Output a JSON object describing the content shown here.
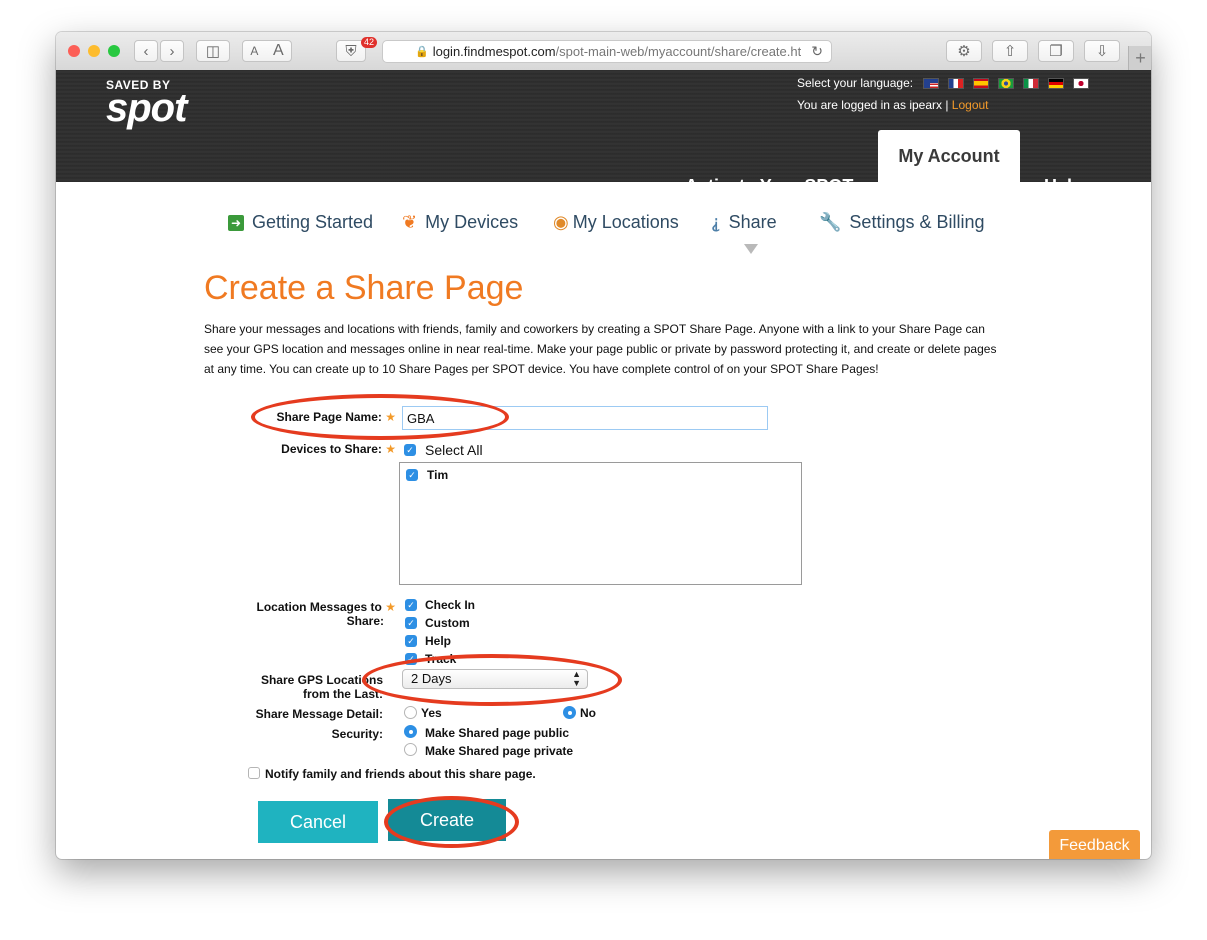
{
  "browser": {
    "url_host": "login.findmespot.com",
    "url_path": "/spot-main-web/myaccount/share/create.ht",
    "badge_count": "42",
    "reader_small": "A",
    "reader_large": "A"
  },
  "header": {
    "logo_top": "SAVED BY",
    "logo_main": "spot",
    "language_label": "Select your language:",
    "logged_in_text": "You are logged in as ipearx |",
    "logout_label": "Logout",
    "nav": [
      "Activate Your SPOT",
      "My Account",
      "Help"
    ]
  },
  "subnav": {
    "getting_started": "Getting Started",
    "my_devices": "My Devices",
    "my_locations": "My Locations",
    "share": "Share",
    "settings_billing": "Settings & Billing"
  },
  "page": {
    "title": "Create a Share Page",
    "intro": "Share your messages and locations with friends, family and coworkers by creating a SPOT Share Page. Anyone with a link to your Share Page can see your GPS location and messages online in near real-time. Make your page public or private by password protecting it, and create or delete pages at any time. You can create up to 10 Share Pages per SPOT device. You have complete control of on your SPOT Share Pages!"
  },
  "form": {
    "share_page_name_label": "Share Page Name:",
    "share_page_name_value": "GBA",
    "devices_label": "Devices to Share:",
    "select_all": "Select All",
    "devices": [
      "Tim"
    ],
    "location_messages_label_1": "Location Messages to",
    "location_messages_label_2": "Share:",
    "messages": [
      "Check In",
      "Custom",
      "Help",
      "Track"
    ],
    "gps_label_1": "Share GPS Locations",
    "gps_label_2": "from the Last:",
    "gps_value": "2 Days",
    "detail_label": "Share Message Detail:",
    "detail_yes": "Yes",
    "detail_no": "No",
    "security_label": "Security:",
    "security_public": "Make Shared page public",
    "security_private": "Make Shared page private",
    "notify_label": "Notify family and friends about this share page.",
    "cancel": "Cancel",
    "create": "Create"
  },
  "feedback": "Feedback",
  "colors": {
    "accent_orange": "#f07a22",
    "teal": "#1fb3c0",
    "teal_dark": "#148a96",
    "highlight_red": "#e53b1f"
  }
}
